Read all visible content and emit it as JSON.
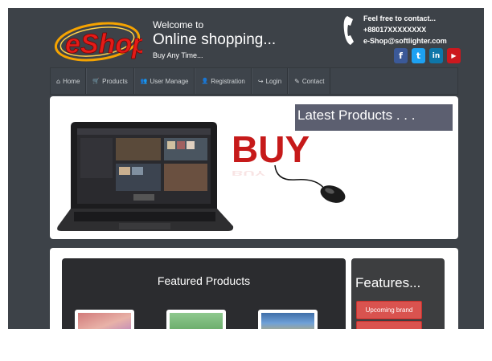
{
  "header": {
    "logo_text": "eShop",
    "welcome_line1": "Welcome to",
    "welcome_line2": "Online shopping...",
    "welcome_line3": "Buy Any Time...",
    "contact_line1": "Feel free to contact...",
    "contact_phone": "+88017XXXXXXXX",
    "contact_email": "e-Shop@softlighter.com",
    "social": [
      {
        "name": "facebook-icon",
        "glyph": "f",
        "color": "#3b5998"
      },
      {
        "name": "twitter-icon",
        "glyph": "t",
        "color": "#1da1f2"
      },
      {
        "name": "linkedin-icon",
        "glyph": "in",
        "color": "#0e76a8"
      },
      {
        "name": "youtube-icon",
        "glyph": "▶",
        "color": "#cc181e"
      }
    ]
  },
  "nav": {
    "items": [
      {
        "label": "Home",
        "icon": "⌂"
      },
      {
        "label": "Products",
        "icon": "🛒"
      },
      {
        "label": "User Manage",
        "icon": "👥"
      },
      {
        "label": "Registration",
        "icon": "👤"
      },
      {
        "label": "Login",
        "icon": "↪"
      },
      {
        "label": "Contact",
        "icon": "✎"
      }
    ]
  },
  "banner": {
    "latest_title": "Latest Products . . .",
    "buy_text": "BUY"
  },
  "featured": {
    "title": "Featured Products"
  },
  "features": {
    "title": "Features...",
    "buttons": [
      "Upcoming brand",
      ""
    ]
  },
  "colors": {
    "page_bg": "#3d4248",
    "accent_red": "#d9534f",
    "latest_bg": "#5c5f70"
  }
}
